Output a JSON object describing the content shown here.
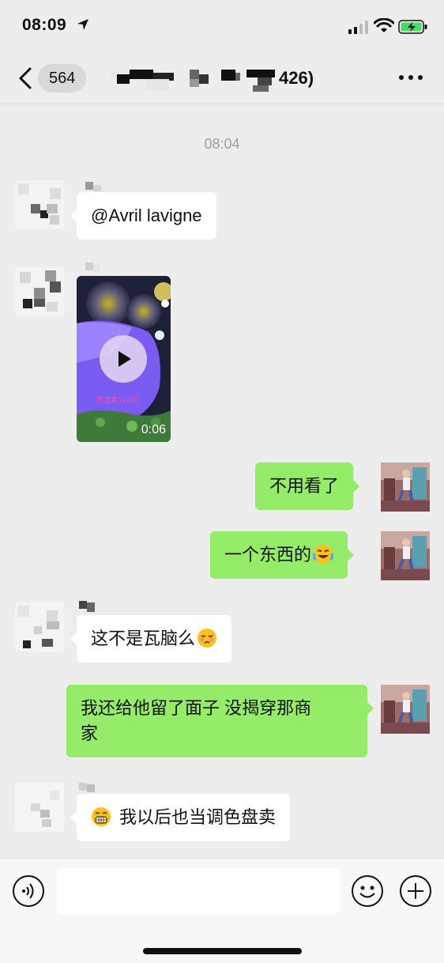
{
  "status_bar": {
    "time": "08:09",
    "location_icon": "location-arrow-icon",
    "signal_icon": "cellular-signal-icon",
    "wifi_icon": "wifi-icon",
    "battery_icon": "battery-charging-icon"
  },
  "nav": {
    "back_icon": "chevron-left-icon",
    "unread_count": "564",
    "title_suffix": "426)",
    "more_icon": "more-dots-icon"
  },
  "chat": {
    "time_divider": "08:04",
    "messages": [
      {
        "side": "left",
        "text": "@Avril lavigne"
      },
      {
        "side": "left",
        "type": "video",
        "duration": "0:06",
        "caption": "恐龙卖120元"
      },
      {
        "side": "right",
        "text": "不用看了"
      },
      {
        "side": "right",
        "text": "一个东西的",
        "emoji": "rofl-emoji-icon"
      },
      {
        "side": "left",
        "text": "这不是瓦脑么",
        "emoji": "smirk-emoji-icon"
      },
      {
        "side": "right",
        "text_line1": "我还给他留了面子 没揭穿那商",
        "text_line2": "家"
      },
      {
        "side": "left",
        "text": "我以后也当调色盘卖",
        "leading_emoji": "grimace-emoji-icon"
      }
    ]
  },
  "input_bar": {
    "voice_icon": "voice-icon",
    "input_placeholder": "",
    "emoji_icon": "smiley-icon",
    "plus_icon": "plus-circle-icon"
  },
  "colors": {
    "background": "#ededed",
    "bubble_self": "#95ec69",
    "bubble_other": "#ffffff",
    "time_gray": "#9e9e9e"
  }
}
